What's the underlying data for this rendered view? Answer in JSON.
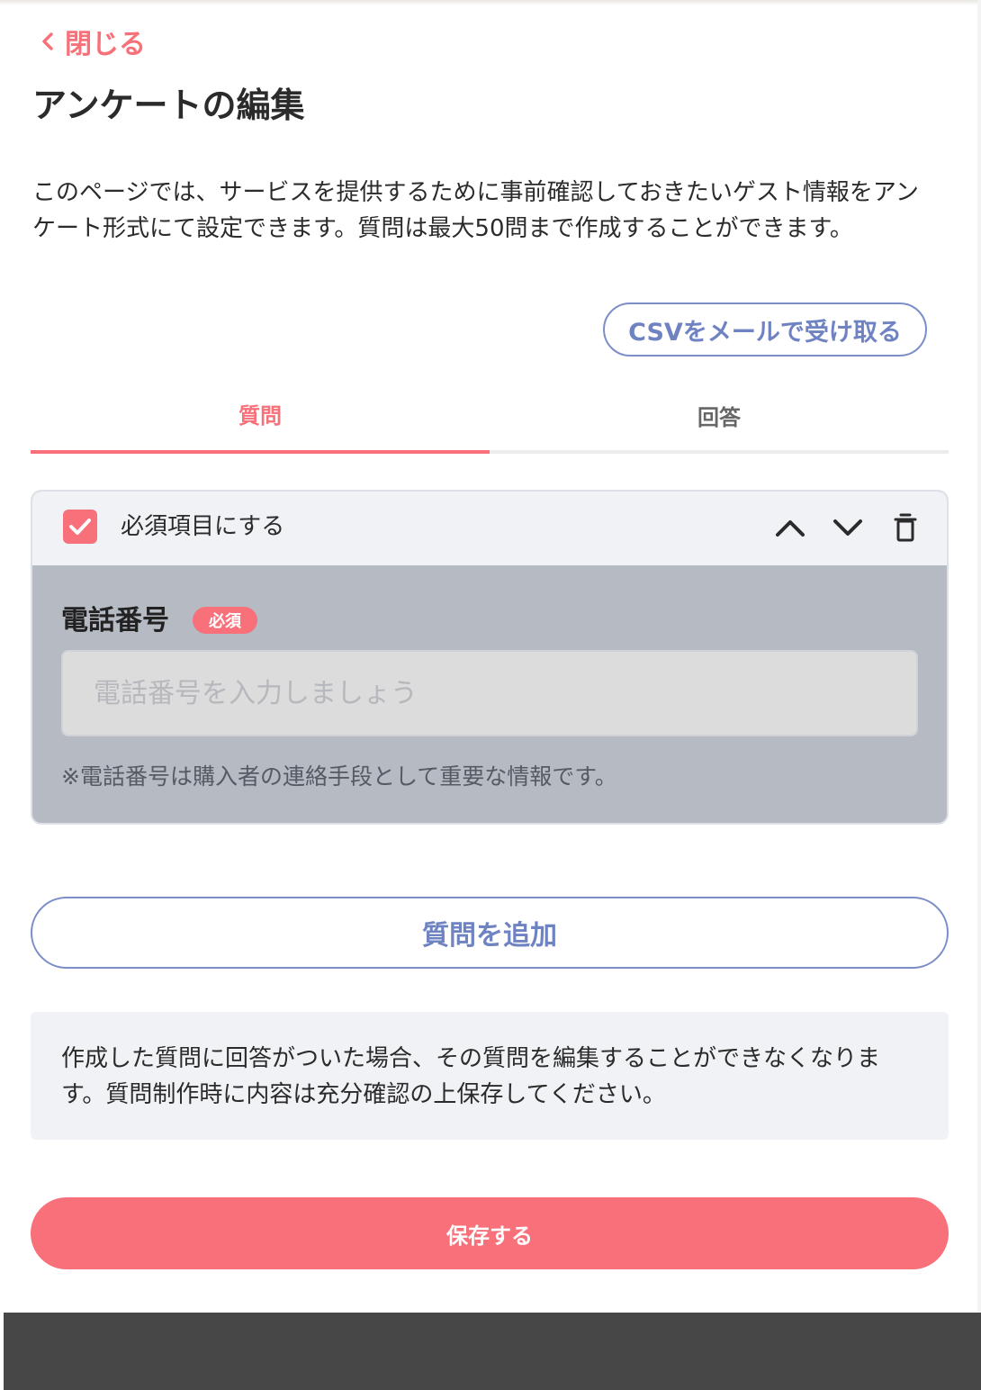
{
  "nav": {
    "close_label": "閉じる"
  },
  "page": {
    "title": "アンケートの編集",
    "intro": "このページでは、サービスを提供するために事前確認しておきたいゲスト情報をアンケート形式にて設定できます。質問は最大50問まで作成することができます。"
  },
  "actions": {
    "csv_label": "CSVをメールで受け取る",
    "add_question_label": "質問を追加",
    "save_label": "保存する"
  },
  "tabs": [
    {
      "label": "質問",
      "active": true
    },
    {
      "label": "回答",
      "active": false
    }
  ],
  "question_card": {
    "required_checked": true,
    "required_toggle_label": "必須項目にする",
    "header_icons": [
      "chevron-up-icon",
      "chevron-down-icon",
      "trash-icon"
    ],
    "field_label": "電話番号",
    "required_badge": "必須",
    "input_value": "",
    "input_placeholder": "電話番号を入力しましょう",
    "helper_text": "※電話番号は購入者の連絡手段として重要な情報です。"
  },
  "notice": {
    "text": "作成した質問に回答がついた場合、その質問を編集することができなくなります。質問制作時に内容は充分確認の上保存してください。"
  },
  "colors": {
    "accent": "#f7707a",
    "link_blue": "#6f83c2",
    "card_body": "#b6bac3",
    "card_header": "#f1f2f6",
    "footer": "#474747"
  }
}
